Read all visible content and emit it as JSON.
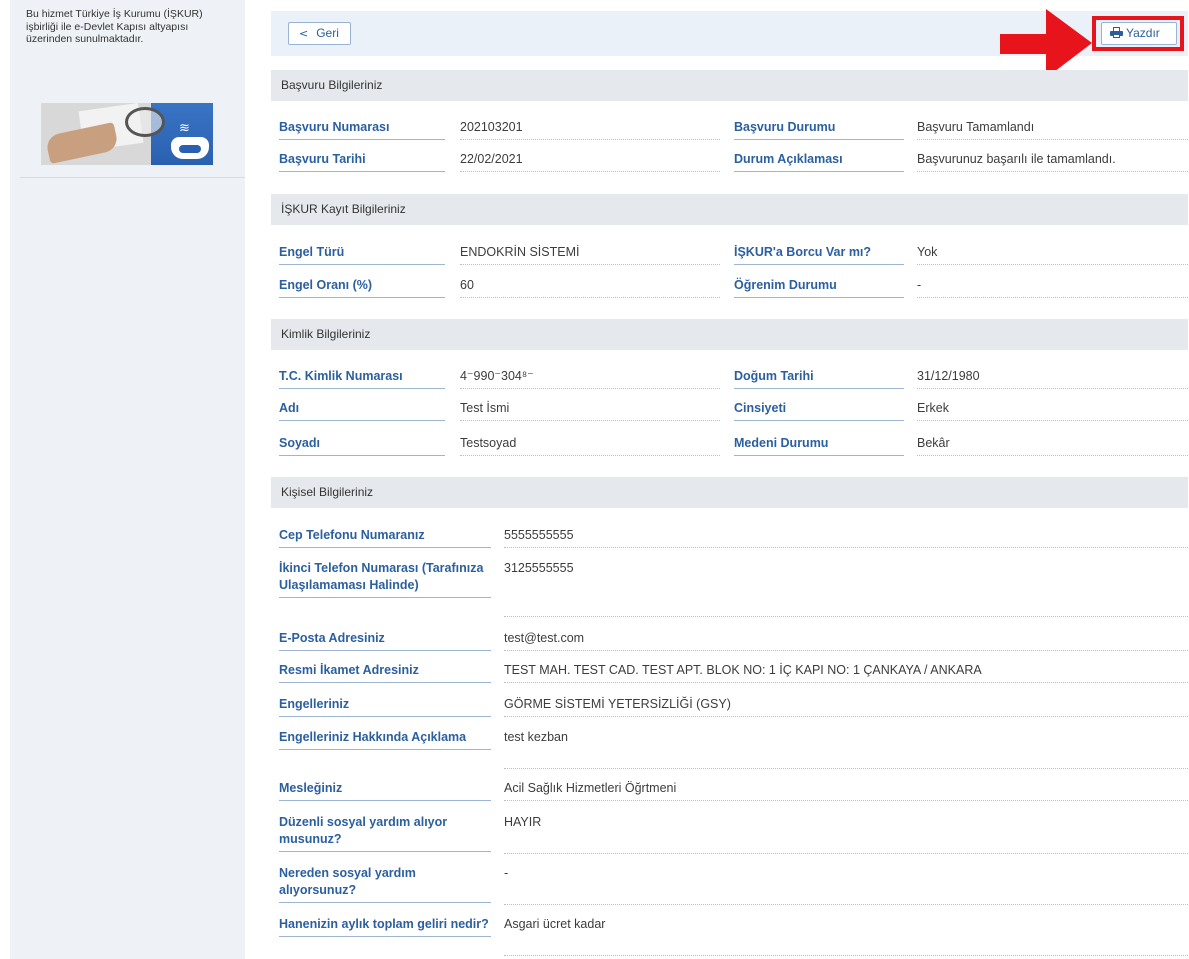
{
  "sidebar": {
    "info_text": "Bu hizmet Türkiye İş Kurumu (İŞKUR) işbirliği ile e-Devlet Kapısı altyapısı üzerinden sunulmaktadır."
  },
  "toolbar": {
    "back_label": "Geri",
    "print_label": "Yazdır"
  },
  "basvuru": {
    "title": "Başvuru Bilgileriniz",
    "rows": [
      [
        {
          "label": "Başvuru Numarası",
          "value": "202103201"
        },
        {
          "label": "Başvuru Durumu",
          "value": "Başvuru Tamamlandı"
        }
      ],
      [
        {
          "label": "Başvuru Tarihi",
          "value": "22/02/2021"
        },
        {
          "label": "Durum Açıklaması",
          "value": "Başvurunuz başarılı ile tamamlandı."
        }
      ]
    ]
  },
  "iskur": {
    "title": "İŞKUR Kayıt Bilgileriniz",
    "rows": [
      [
        {
          "label": "Engel Türü",
          "value": "ENDOKRİN SİSTEMİ"
        },
        {
          "label": "İŞKUR'a Borcu Var mı?",
          "value": "Yok"
        }
      ],
      [
        {
          "label": "Engel Oranı (%)",
          "value": "60"
        },
        {
          "label": "Öğrenim Durumu",
          "value": "-"
        }
      ]
    ]
  },
  "kimlik": {
    "title": "Kimlik Bilgileriniz",
    "rows": [
      [
        {
          "label": "T.C. Kimlik Numarası",
          "value": "4⁻990⁻304⁸⁻"
        },
        {
          "label": "Doğum Tarihi",
          "value": "31/12/1980"
        }
      ],
      [
        {
          "label": "Adı",
          "value": "Test İsmi"
        },
        {
          "label": "Cinsiyeti",
          "value": "Erkek"
        }
      ],
      [
        {
          "label": "Soyadı",
          "value": "Testsoyad"
        },
        {
          "label": "Medeni Durumu",
          "value": "Bekâr"
        }
      ]
    ]
  },
  "kisisel": {
    "title": "Kişisel Bilgileriniz",
    "rows": [
      {
        "label": "Cep Telefonu Numaranız",
        "value": "5555555555"
      },
      {
        "label": "İkinci Telefon Numarası (Tarafınıza Ulaşılamaması Halinde)",
        "value": "3125555555"
      },
      {
        "label": "E-Posta Adresiniz",
        "value": "test@test.com"
      },
      {
        "label": "Resmi İkamet Adresiniz",
        "value": "TEST MAH. TEST CAD. TEST APT. BLOK NO: 1 İÇ KAPI NO: 1 ÇANKAYA / ANKARA"
      },
      {
        "label": "Engelleriniz",
        "value": "GÖRME SİSTEMİ YETERSİZLİĞİ (GSY)"
      },
      {
        "label": "Engelleriniz Hakkında Açıklama",
        "value": "test kezban"
      },
      {
        "label": "Mesleğiniz",
        "value": "Acil Sağlık Hizmetleri Öğrtmeni"
      },
      {
        "label": "Düzenli sosyal yardım alıyor musunuz?",
        "value": "HAYIR"
      },
      {
        "label": "Nereden sosyal yardım alıyorsunuz?",
        "value": "-"
      },
      {
        "label": "Hanenizin aylık toplam geliri nedir?",
        "value": "Asgari ücret kadar"
      }
    ]
  },
  "colors": {
    "label": "#2b5fa0",
    "highlight": "#e8141c",
    "section_bg": "#e5e8ec"
  }
}
